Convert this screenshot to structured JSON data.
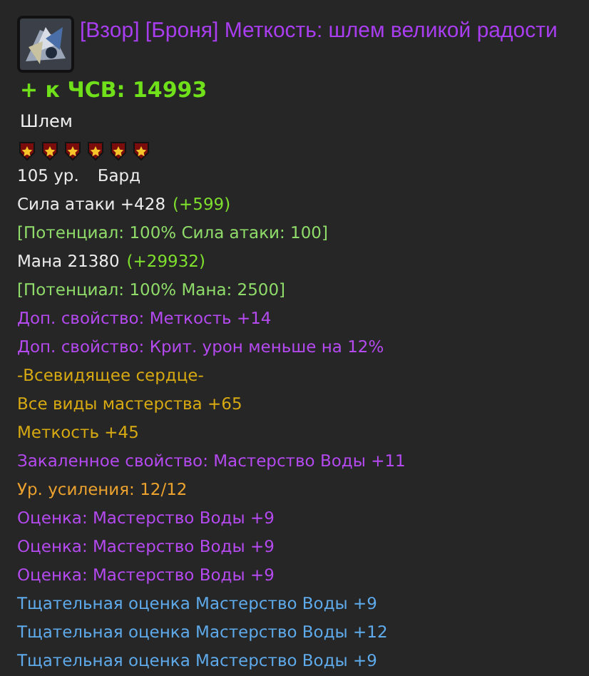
{
  "title": "[Взор] [Броня] Меткость: шлем великой радости",
  "bonus": "+ к ЧСВ: 14993",
  "item_type": "Шлем",
  "stars": 6,
  "lines": [
    {
      "segments": [
        {
          "text": "105 ур.",
          "color": "#ececec"
        },
        {
          "text": "Бард",
          "color": "#ececec"
        }
      ]
    },
    {
      "segments": [
        {
          "text": "Сила атаки +428",
          "color": "#ececec"
        },
        {
          "text": "(+599)",
          "color": "#7fe02e"
        }
      ]
    },
    {
      "segments": [
        {
          "text": "[Потенциал: 100% Сила атаки: 100]",
          "color": "#8fdc6a"
        }
      ]
    },
    {
      "segments": [
        {
          "text": "Мана 21380",
          "color": "#ececec"
        },
        {
          "text": "(+29932)",
          "color": "#7fe02e"
        }
      ]
    },
    {
      "segments": [
        {
          "text": "[Потенциал: 100% Мана: 2500]",
          "color": "#8fdc6a"
        }
      ]
    },
    {
      "segments": [
        {
          "text": "Доп. свойство: Меткость +14",
          "color": "#b44af0"
        }
      ]
    },
    {
      "segments": [
        {
          "text": "Доп. свойство: Крит. урон меньше на 12%",
          "color": "#b44af0"
        }
      ]
    },
    {
      "segments": [
        {
          "text": "-Всевидящее сердце-",
          "color": "#d8aa12"
        }
      ]
    },
    {
      "segments": [
        {
          "text": "Все виды мастерства +65",
          "color": "#d8aa12"
        }
      ]
    },
    {
      "segments": [
        {
          "text": "Меткость +45",
          "color": "#d8aa12"
        }
      ]
    },
    {
      "segments": [
        {
          "text": "Закаленное свойство: Мастерство Воды +11",
          "color": "#b44af0"
        }
      ]
    },
    {
      "segments": [
        {
          "text": "Ур. усиления: 12/12",
          "color": "#eba22e"
        }
      ]
    },
    {
      "segments": [
        {
          "text": "Оценка:  Мастерство Воды +9",
          "color": "#b44af0"
        }
      ]
    },
    {
      "segments": [
        {
          "text": "Оценка:  Мастерство Воды +9",
          "color": "#b44af0"
        }
      ]
    },
    {
      "segments": [
        {
          "text": "Оценка:  Мастерство Воды +9",
          "color": "#b44af0"
        }
      ]
    },
    {
      "segments": [
        {
          "text": "Тщательная оценка Мастерство Воды +9",
          "color": "#5eaaea"
        }
      ]
    },
    {
      "segments": [
        {
          "text": "Тщательная оценка Мастерство Воды +12",
          "color": "#5eaaea"
        }
      ]
    },
    {
      "segments": [
        {
          "text": "Тщательная оценка Мастерство Воды +9",
          "color": "#5eaaea"
        }
      ]
    }
  ]
}
